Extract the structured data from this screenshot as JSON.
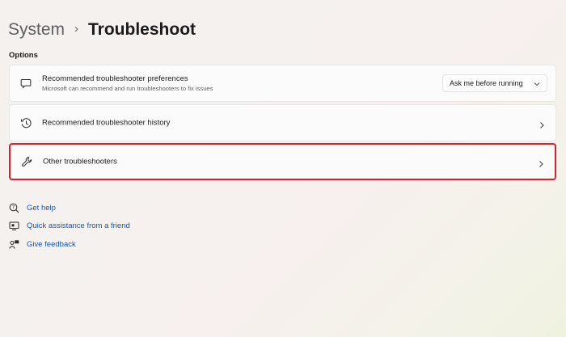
{
  "breadcrumb": {
    "parent": "System",
    "separator": "›",
    "current": "Troubleshoot"
  },
  "section": {
    "title": "Options"
  },
  "cards": [
    {
      "icon": "chat-bubble-icon",
      "title": "Recommended troubleshooter preferences",
      "subtitle": "Microsoft can recommend and run troubleshooters to fix issues",
      "dropdown_value": "Ask me before running"
    },
    {
      "icon": "history-icon",
      "title": "Recommended troubleshooter history"
    },
    {
      "icon": "wrench-icon",
      "title": "Other troubleshooters",
      "highlighted": true,
      "highlight_color": "#d9202b"
    }
  ],
  "links": [
    {
      "icon": "help-icon",
      "label": "Get help"
    },
    {
      "icon": "quick-assist-icon",
      "label": "Quick assistance from a friend"
    },
    {
      "icon": "feedback-icon",
      "label": "Give feedback"
    }
  ],
  "colors": {
    "link": "#1a56a6",
    "highlight": "#d9202b"
  }
}
